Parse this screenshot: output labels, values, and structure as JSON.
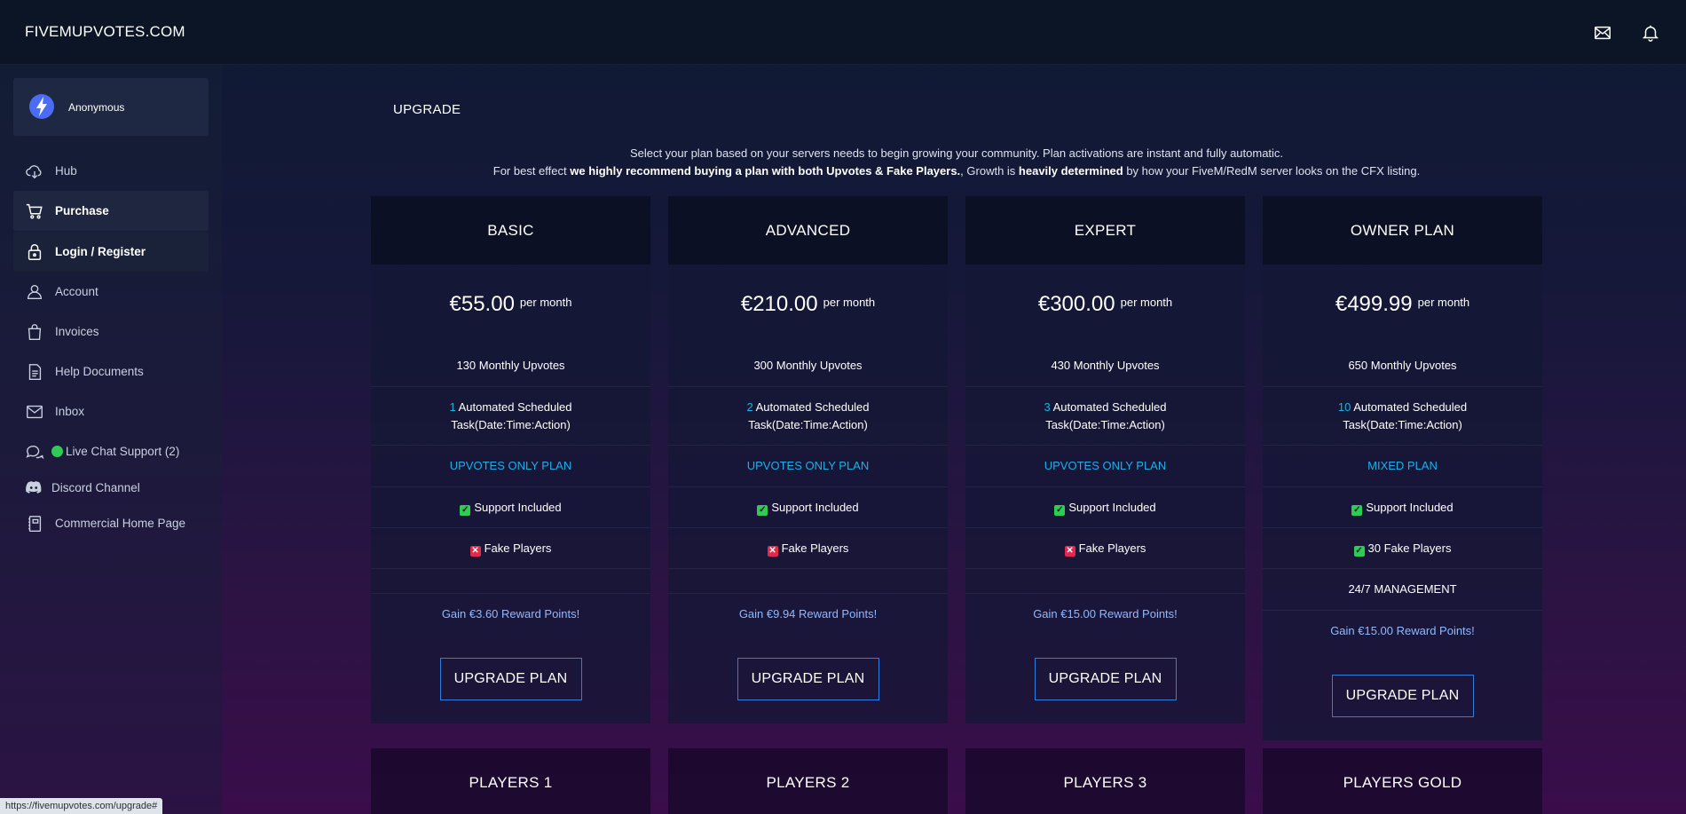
{
  "app": {
    "brand": "FIVEMUPVOTES.COM"
  },
  "header": {
    "icons": [
      "mail-icon",
      "bell-icon"
    ]
  },
  "user": {
    "name": "Anonymous"
  },
  "sidebar": {
    "items": [
      {
        "label": "Hub",
        "icon": "cloud-icon"
      },
      {
        "label": "Purchase",
        "icon": "cart-icon"
      },
      {
        "label": "Login / Register",
        "icon": "lock-icon"
      },
      {
        "label": "Account",
        "icon": "user-icon"
      },
      {
        "label": "Invoices",
        "icon": "bag-icon"
      },
      {
        "label": "Help Documents",
        "icon": "document-icon"
      },
      {
        "label": "Inbox",
        "icon": "mail-icon"
      },
      {
        "label": "Live Chat Support (2)",
        "icon": "chat-icon"
      },
      {
        "label": "Discord Channel",
        "icon": "discord-icon"
      },
      {
        "label": "Commercial Home Page",
        "icon": "book-icon"
      }
    ]
  },
  "main": {
    "title": "UPGRADE",
    "intro_line1": "Select your plan based on your servers needs to begin growing your community. Plan activations are instant and fully automatic.",
    "intro_line2_a": "For best effect ",
    "intro_line2_b": "we highly recommend buying a plan with both Upvotes & Fake Players.",
    "intro_line2_c": ", Growth is ",
    "intro_line2_d": "heavily determined",
    "intro_line2_e": " by how your FiveM/RedM server looks on the CFX listing."
  },
  "plans": [
    {
      "name": "BASIC",
      "price": "€55.00",
      "per": "per month",
      "upvotes": "130 Monthly Upvotes",
      "tasks_n": "1",
      "tasks_l1": " Automated Scheduled",
      "tasks_l2": "Task(Date:Time:Action)",
      "type": "UPVOTES ONLY PLAN",
      "support": "Support Included",
      "fake": "Fake Players",
      "gain": "Gain €3.60 Reward Points!",
      "button": "UPGRADE PLAN"
    },
    {
      "name": "ADVANCED",
      "price": "€210.00",
      "per": "per month",
      "upvotes": "300 Monthly Upvotes",
      "tasks_n": "2",
      "tasks_l1": " Automated Scheduled",
      "tasks_l2": "Task(Date:Time:Action)",
      "type": "UPVOTES ONLY PLAN",
      "support": "Support Included",
      "fake": "Fake Players",
      "gain": "Gain €9.94 Reward Points!",
      "button": "UPGRADE PLAN"
    },
    {
      "name": "EXPERT",
      "price": "€300.00",
      "per": "per month",
      "upvotes": "430 Monthly Upvotes",
      "tasks_n": "3",
      "tasks_l1": " Automated Scheduled",
      "tasks_l2": "Task(Date:Time:Action)",
      "type": "UPVOTES ONLY PLAN",
      "support": "Support Included",
      "fake": "Fake Players",
      "gain": "Gain €15.00 Reward Points!",
      "button": "UPGRADE PLAN"
    },
    {
      "name": "OWNER PLAN",
      "price": "€499.99",
      "per": "per month",
      "upvotes": "650 Monthly Upvotes",
      "tasks_n": "10",
      "tasks_l1": " Automated Scheduled",
      "tasks_l2": "Task(Date:Time:Action)",
      "type": "MIXED PLAN",
      "support": "Support Included",
      "fake": "30 Fake Players",
      "management": "24/7 MANAGEMENT",
      "gain": "Gain €15.00 Reward Points!",
      "button": "UPGRADE PLAN"
    }
  ],
  "player_plans": [
    {
      "name": "PLAYERS 1"
    },
    {
      "name": "PLAYERS 2"
    },
    {
      "name": "PLAYERS 3"
    },
    {
      "name": "PLAYERS GOLD"
    }
  ],
  "status_bar": {
    "url": "https://fivemupvotes.com/upgrade#"
  },
  "colors": {
    "accent": "#1dafe8",
    "button_border": "#2f7fe0",
    "check_green": "#2ecc55",
    "cross_red": "#e0294c",
    "reward_text": "#8eb9ff"
  }
}
